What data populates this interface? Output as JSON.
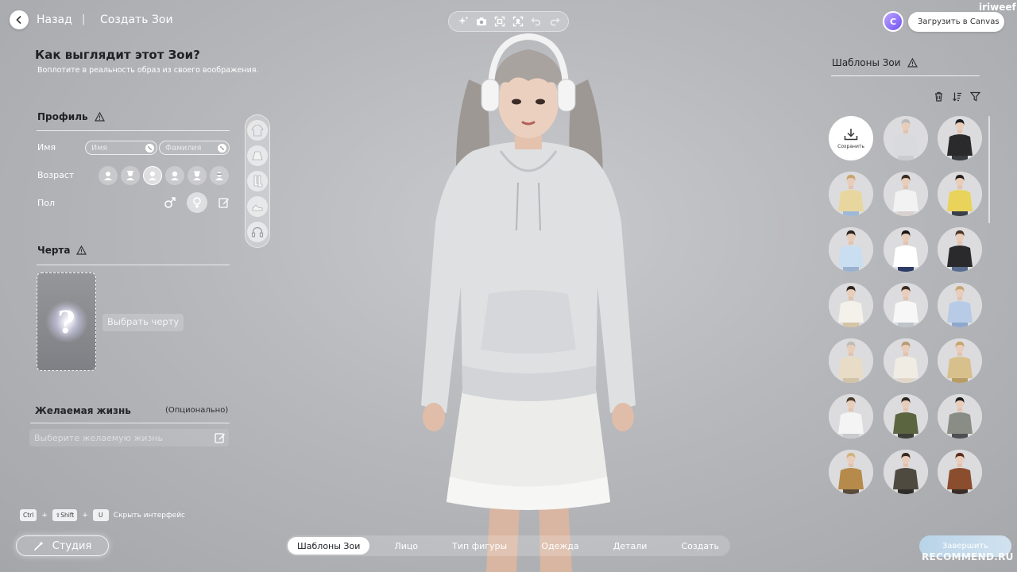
{
  "top": {
    "back_label": "Назад",
    "separator": "|",
    "breadcrumb": "Создать Зои",
    "upload_label": "Загрузить в Canvas",
    "canvas_logo_letter": "C",
    "username": "iriweef",
    "toolbar_icons": [
      "sparkle-icon",
      "camera-icon",
      "frame-icon",
      "focus-icon",
      "undo-icon",
      "redo-icon"
    ]
  },
  "intro": {
    "title": "Как выглядит этот Зои?",
    "subtitle": "Воплотите в реальность образ из своего воображения."
  },
  "profile": {
    "title": "Профиль",
    "name_label": "Имя",
    "first_name_placeholder": "Имя",
    "last_name_placeholder": "Фамилия",
    "age_label": "Возраст",
    "age_options": [
      "baby",
      "child",
      "teen",
      "young-adult",
      "adult",
      "elder"
    ],
    "age_selected": 2,
    "gender_label": "Пол",
    "gender_selected": "female"
  },
  "trait": {
    "title": "Черта",
    "question_mark": "?",
    "choose_label": "Выбрать черту"
  },
  "life": {
    "title": "Желаемая жизнь",
    "optional": "(Опционально)",
    "placeholder": "Выберите желаемую жизнь"
  },
  "shortcut": {
    "key1": "Ctrl",
    "plus": "+",
    "key2": "⇧Shift",
    "key3": "U",
    "label": "Скрыть интерфейс"
  },
  "studio_label": "Студия",
  "bottom_nav": {
    "tabs": [
      {
        "label": "Шаблоны Зои",
        "active": true
      },
      {
        "label": "Лицо",
        "active": false
      },
      {
        "label": "Тип фигуры",
        "active": false
      },
      {
        "label": "Одежда",
        "active": false
      },
      {
        "label": "Детали",
        "active": false
      },
      {
        "label": "Создать",
        "active": false
      }
    ]
  },
  "finish_label": "Завершить",
  "watermark": "RECOMMEND.RU",
  "templates": {
    "title": "Шаблоны Зои",
    "save_label": "Сохранить",
    "items": [
      {
        "top": "#d8dadd",
        "bottom": "#c9ccd0",
        "hair": "#b9b9bd"
      },
      {
        "top": "#2a2a2c",
        "bottom": "#3a3b3e",
        "hair": "#1f1f21"
      },
      {
        "top": "#e7d79e",
        "bottom": "#9fb8d6",
        "hair": "#c9a26f"
      },
      {
        "top": "#f2f2f2",
        "bottom": "#d9d0d0",
        "hair": "#3b2a22"
      },
      {
        "top": "#e9d35a",
        "bottom": "#3b3f48",
        "hair": "#2a1c16"
      },
      {
        "top": "#c9def0",
        "bottom": "#9ab2cf",
        "hair": "#2c2622"
      },
      {
        "top": "#ffffff",
        "bottom": "#2c3b66",
        "hair": "#1a1616"
      },
      {
        "top": "#2a2a2c",
        "bottom": "#5a6d8e",
        "hair": "#4a3626"
      },
      {
        "top": "#f4f1ea",
        "bottom": "#d5c5a6",
        "hair": "#2e221c"
      },
      {
        "top": "#f7f7f7",
        "bottom": "#bfc4ca",
        "hair": "#3a2b22"
      },
      {
        "top": "#b7cbe7",
        "bottom": "#8ea8cc",
        "hair": "#c6a574"
      },
      {
        "top": "#e8dcc6",
        "bottom": "#d2c3a8",
        "hair": "#bfbcb5"
      },
      {
        "top": "#f1ece3",
        "bottom": "#e0d7c8",
        "hair": "#b79a74"
      },
      {
        "top": "#d8c08c",
        "bottom": "#b89c64",
        "hair": "#caa36a"
      },
      {
        "top": "#f4f4f4",
        "bottom": "#c9cacd",
        "hair": "#4a3b2e"
      },
      {
        "top": "#5b6540",
        "bottom": "#3c3f37",
        "hair": "#2d241d"
      },
      {
        "top": "#8a8c86",
        "bottom": "#4d4f53",
        "hair": "#1f1d1c"
      },
      {
        "top": "#b58a4a",
        "bottom": "#5b4a3a",
        "hair": "#d2b27c"
      },
      {
        "top": "#4e4a3f",
        "bottom": "#2f2d2a",
        "hair": "#3a2a20"
      },
      {
        "top": "#8a4d2e",
        "bottom": "#3a2e28",
        "hair": "#5a2b1e"
      }
    ]
  },
  "colors": {
    "accent_canvas": "#6e52f2",
    "finish_button": "#c6dcec",
    "panel_text": "#1f2126"
  }
}
